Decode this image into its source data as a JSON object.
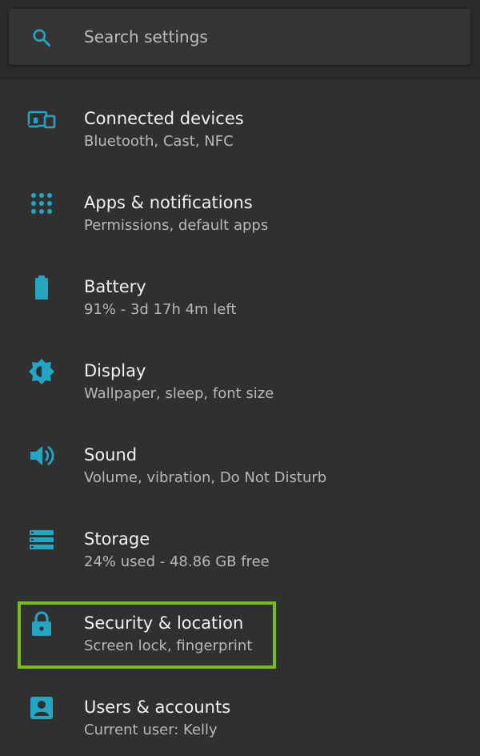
{
  "search": {
    "placeholder": "Search settings"
  },
  "colors": {
    "accent": "#26a5c2",
    "highlight": "#7dbb1b",
    "background": "#303030"
  },
  "settings": [
    {
      "title": "Connected devices",
      "subtitle": "Bluetooth, Cast, NFC",
      "icon": "devices-icon"
    },
    {
      "title": "Apps & notifications",
      "subtitle": "Permissions, default apps",
      "icon": "apps-grid-icon"
    },
    {
      "title": "Battery",
      "subtitle": "91% - 3d 17h 4m left",
      "icon": "battery-icon"
    },
    {
      "title": "Display",
      "subtitle": "Wallpaper, sleep, font size",
      "icon": "brightness-icon"
    },
    {
      "title": "Sound",
      "subtitle": "Volume, vibration, Do Not Disturb",
      "icon": "volume-icon"
    },
    {
      "title": "Storage",
      "subtitle": "24% used - 48.86 GB free",
      "icon": "storage-icon"
    },
    {
      "title": "Security & location",
      "subtitle": "Screen lock, fingerprint",
      "icon": "lock-icon"
    },
    {
      "title": "Users & accounts",
      "subtitle": "Current user: Kelly",
      "icon": "account-box-icon"
    }
  ]
}
